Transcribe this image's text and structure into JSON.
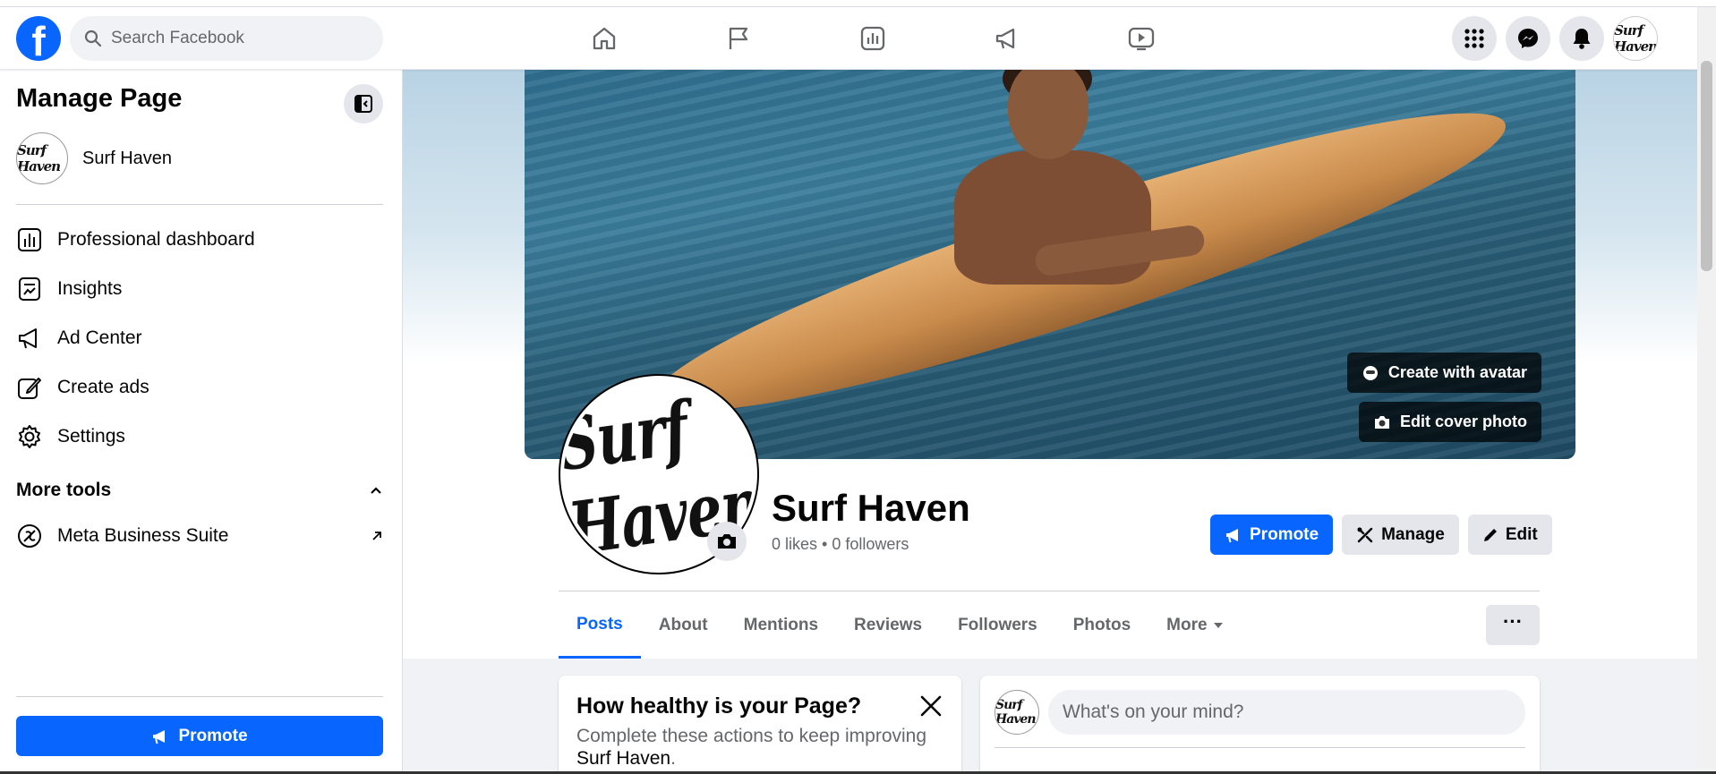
{
  "topbar": {
    "logo": "f",
    "search_placeholder": "Search Facebook",
    "nav_icons": [
      "home-icon",
      "flag-icon",
      "insights-icon",
      "megaphone-icon",
      "video-icon"
    ],
    "right_icons": [
      "menu-grid-icon",
      "messenger-icon",
      "bell-icon"
    ],
    "avatar_text": "Surf Haven"
  },
  "sidebar": {
    "title": "Manage Page",
    "page_name": "Surf Haven",
    "items": [
      {
        "label": "Professional dashboard",
        "icon": "dashboard-icon"
      },
      {
        "label": "Insights",
        "icon": "insights-icon"
      },
      {
        "label": "Ad Center",
        "icon": "megaphone-icon"
      },
      {
        "label": "Create ads",
        "icon": "edit-icon"
      },
      {
        "label": "Settings",
        "icon": "gear-icon"
      }
    ],
    "more_tools": "More tools",
    "tools": [
      {
        "label": "Meta Business Suite",
        "icon": "meta-icon"
      }
    ],
    "promote": "Promote"
  },
  "cover": {
    "create_avatar": "Create with avatar",
    "edit_cover": "Edit cover photo"
  },
  "profile": {
    "logo_text": "Surf Haven",
    "name": "Surf Haven",
    "stats": "0 likes • 0 followers",
    "buttons": {
      "promote": "Promote",
      "manage": "Manage",
      "edit": "Edit"
    }
  },
  "tabs": [
    {
      "label": "Posts",
      "active": true
    },
    {
      "label": "About"
    },
    {
      "label": "Mentions"
    },
    {
      "label": "Reviews"
    },
    {
      "label": "Followers"
    },
    {
      "label": "Photos"
    },
    {
      "label": "More"
    }
  ],
  "more_options": "···",
  "health": {
    "title": "How healthy is your Page?",
    "desc": "Complete these actions to keep improving",
    "page": "Surf Haven",
    "period": "."
  },
  "composer": {
    "placeholder": "What's on your mind?"
  },
  "colors": {
    "brand": "#0866ff",
    "bg": "#f0f2f5"
  }
}
